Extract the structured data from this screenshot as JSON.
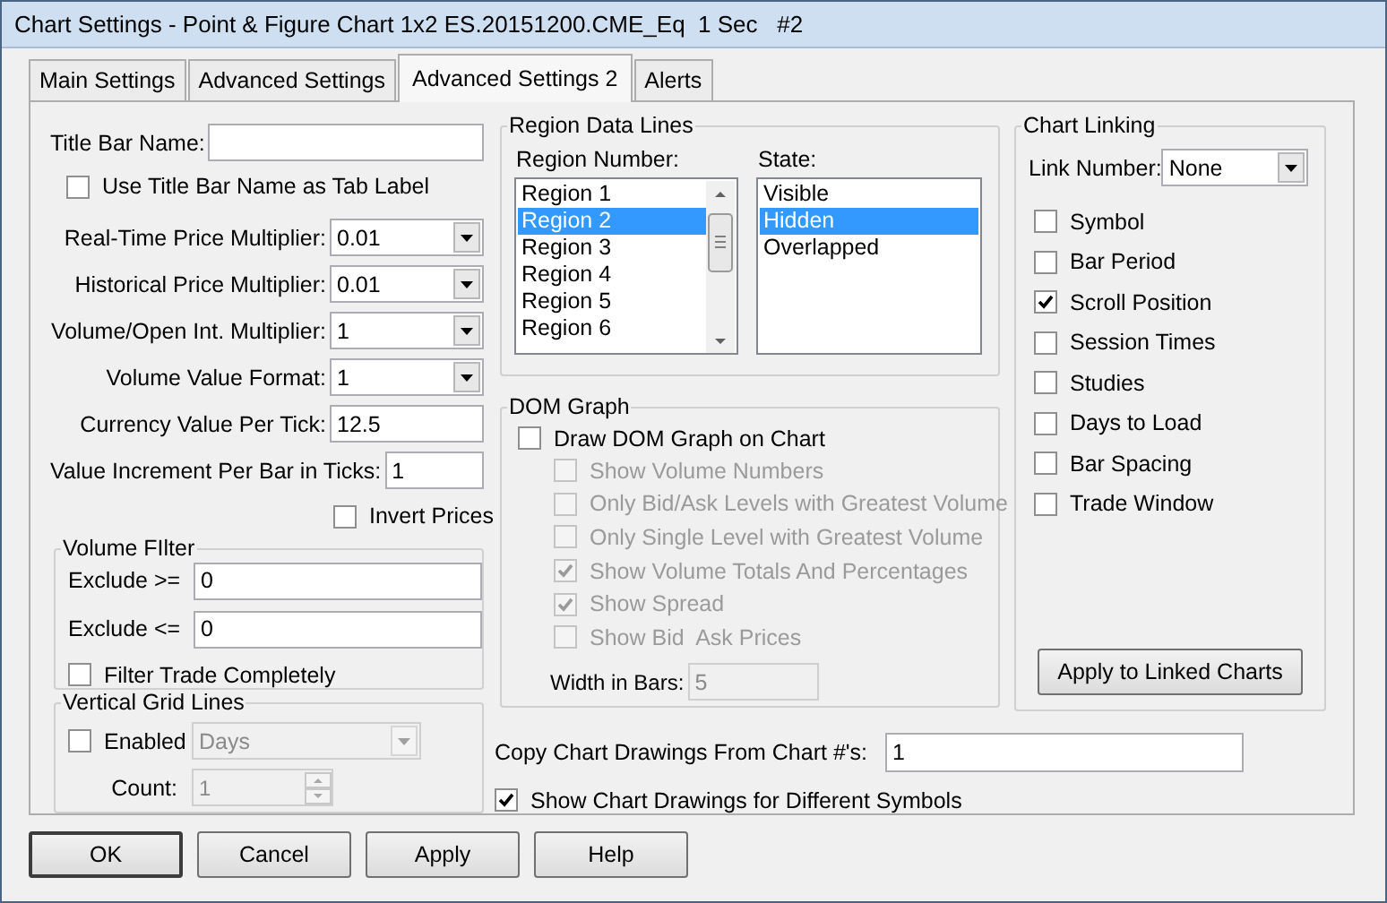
{
  "window": {
    "title": "Chart Settings - Point & Figure Chart 1x2 ES.20151200.CME_Eq  1 Sec   #2"
  },
  "tabs": [
    {
      "label": "Main Settings",
      "selected": false
    },
    {
      "label": "Advanced Settings",
      "selected": false
    },
    {
      "label": "Advanced Settings 2",
      "selected": true
    },
    {
      "label": "Alerts",
      "selected": false
    }
  ],
  "title_bar_name": {
    "label": "Title Bar Name:"
  },
  "use_title_bar_name": {
    "label": "Use Title Bar Name as Tab Label",
    "checked": false
  },
  "fields": [
    {
      "kind": "dropdown",
      "label": "Real-Time Price Multiplier:",
      "value": "0.01"
    },
    {
      "kind": "dropdown",
      "label": "Historical Price Multiplier:",
      "value": "0.01"
    },
    {
      "kind": "dropdown",
      "label": "Volume/Open Int. Multiplier:",
      "value": "1"
    },
    {
      "kind": "dropdown",
      "label": "Volume Value Format:",
      "value": "1"
    },
    {
      "kind": "text",
      "label": "Currency Value Per Tick:",
      "value": "12.5"
    },
    {
      "kind": "text",
      "label": "Value Increment Per Bar in Ticks:",
      "value": "1"
    }
  ],
  "invert_prices": {
    "label": "Invert Prices",
    "checked": false
  },
  "volume_filter": {
    "title": "Volume FIlter",
    "fields": [
      {
        "label": "Exclude >=",
        "value": "0"
      },
      {
        "label": "Exclude <=",
        "value": "0"
      }
    ],
    "filter_trade": {
      "label": "Filter Trade Completely",
      "checked": false
    }
  },
  "vertical_grid_lines": {
    "title": "Vertical Grid Lines",
    "enabled": {
      "label": "Enabled",
      "checked": false
    },
    "interval": {
      "value": "Days",
      "disabled": true
    },
    "count": {
      "label": "Count:",
      "value": "1",
      "disabled": true
    }
  },
  "region_data_lines": {
    "title": "Region Data Lines",
    "region_number": {
      "label": "Region Number:",
      "items": [
        {
          "label": "Region 1",
          "selected": false
        },
        {
          "label": "Region 2",
          "selected": true
        },
        {
          "label": "Region 3",
          "selected": false
        },
        {
          "label": "Region 4",
          "selected": false
        },
        {
          "label": "Region 5",
          "selected": false
        },
        {
          "label": "Region 6",
          "selected": false
        }
      ]
    },
    "state": {
      "label": "State:",
      "items": [
        {
          "label": "Visible",
          "selected": false
        },
        {
          "label": "Hidden",
          "selected": true
        },
        {
          "label": "Overlapped",
          "selected": false
        }
      ]
    }
  },
  "dom_graph": {
    "title": "DOM Graph",
    "draw": {
      "label": "Draw DOM Graph on Chart",
      "checked": false
    },
    "options": [
      {
        "label": "Show Volume Numbers",
        "checked": false,
        "disabled": true
      },
      {
        "label": "Only Bid/Ask Levels with Greatest Volume",
        "checked": false,
        "disabled": true
      },
      {
        "label": "Only Single Level with Greatest Volume",
        "checked": false,
        "disabled": true
      },
      {
        "label": "Show Volume Totals And Percentages",
        "checked": true,
        "disabled": true
      },
      {
        "label": "Show Spread",
        "checked": true,
        "disabled": true
      },
      {
        "label": "Show Bid  Ask Prices",
        "checked": false,
        "disabled": true
      }
    ],
    "width": {
      "label": "Width in Bars:",
      "value": "5",
      "disabled": true
    }
  },
  "chart_linking": {
    "title": "Chart Linking",
    "link_number": {
      "label": "Link Number:",
      "value": "None"
    },
    "options": [
      {
        "label": "Symbol",
        "checked": false
      },
      {
        "label": "Bar Period",
        "checked": false
      },
      {
        "label": "Scroll Position",
        "checked": true
      },
      {
        "label": "Session Times",
        "checked": false
      },
      {
        "label": "Studies",
        "checked": false
      },
      {
        "label": "Days to Load",
        "checked": false
      },
      {
        "label": "Bar Spacing",
        "checked": false
      },
      {
        "label": "Trade Window",
        "checked": false
      }
    ],
    "apply_button": "Apply to Linked Charts"
  },
  "copy_drawings": {
    "label": "Copy Chart Drawings From Chart #'s:",
    "value": "1"
  },
  "show_drawings": {
    "label": "Show Chart Drawings for Different Symbols",
    "checked": true
  },
  "buttons": [
    {
      "label": "OK",
      "default": true
    },
    {
      "label": "Cancel",
      "default": false
    },
    {
      "label": "Apply",
      "default": false
    },
    {
      "label": "Help",
      "default": false
    }
  ]
}
